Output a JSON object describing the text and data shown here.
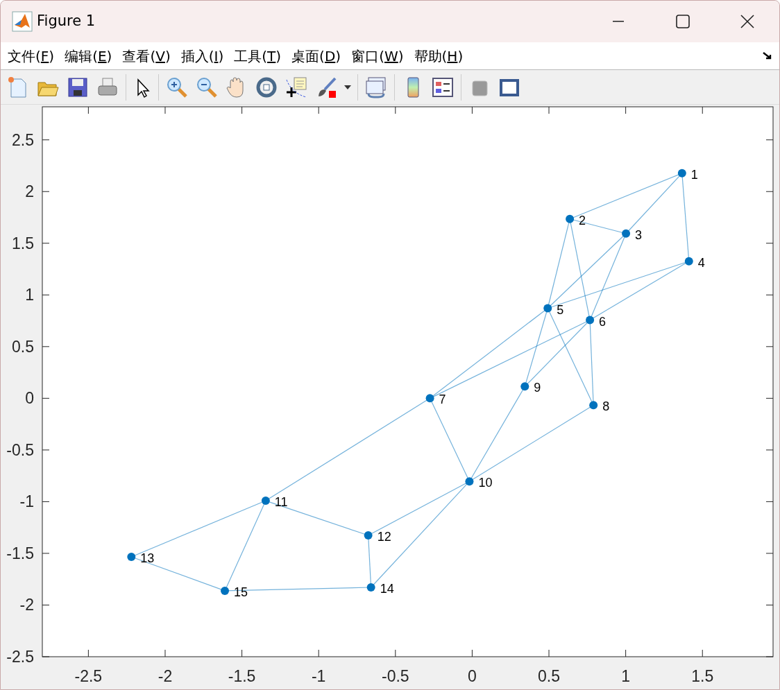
{
  "window": {
    "title": "Figure 1"
  },
  "menu": [
    {
      "label": "文件(F)"
    },
    {
      "label": "编辑(E)"
    },
    {
      "label": "查看(V)"
    },
    {
      "label": "插入(I)"
    },
    {
      "label": "工具(T)"
    },
    {
      "label": "桌面(D)"
    },
    {
      "label": "窗口(W)"
    },
    {
      "label": "帮助(H)"
    }
  ],
  "plot": {
    "chart_data": {
      "type": "scatter",
      "xlim": [
        -2.8,
        1.96
      ],
      "ylim": [
        -2.5,
        2.82
      ],
      "xticks": [
        {
          "value": -2.5,
          "label": "-2.5"
        },
        {
          "value": -2,
          "label": "-2"
        },
        {
          "value": -1.5,
          "label": "-1.5"
        },
        {
          "value": -1,
          "label": "-1"
        },
        {
          "value": -0.5,
          "label": "-0.5"
        },
        {
          "value": 0,
          "label": "0"
        },
        {
          "value": 0.5,
          "label": "0.5"
        },
        {
          "value": 1,
          "label": "1"
        },
        {
          "value": 1.5,
          "label": "1.5"
        }
      ],
      "yticks": [
        {
          "value": -2.5,
          "label": "-2.5"
        },
        {
          "value": -2,
          "label": "-2"
        },
        {
          "value": -1.5,
          "label": "-1.5"
        },
        {
          "value": -1,
          "label": "-1"
        },
        {
          "value": -0.5,
          "label": "-0.5"
        },
        {
          "value": 0,
          "label": "0"
        },
        {
          "value": 0.5,
          "label": "0.5"
        },
        {
          "value": 1,
          "label": "1"
        },
        {
          "value": 1.5,
          "label": "1.5"
        },
        {
          "value": 2,
          "label": "2"
        },
        {
          "value": 2.5,
          "label": "2.5"
        }
      ],
      "x": [
        1.367,
        0.636,
        1.002,
        1.412,
        0.492,
        0.767,
        -0.275,
        0.79,
        0.343,
        -0.018,
        -1.345,
        -0.677,
        -2.22,
        -0.659,
        -1.611
      ],
      "series": [
        {
          "color": "#0072bd",
          "values": [
            2.177,
            1.735,
            1.594,
            1.326,
            0.871,
            0.757,
            0,
            -0.067,
            0.114,
            -0.804,
            -0.991,
            -1.326,
            -1.534,
            -1.829,
            -1.862
          ]
        }
      ],
      "value_labels": [
        "1",
        "2",
        "3",
        "4",
        "5",
        "6",
        "7",
        "8",
        "9",
        "10",
        "11",
        "12",
        "13",
        "14",
        "15"
      ]
    }
  }
}
